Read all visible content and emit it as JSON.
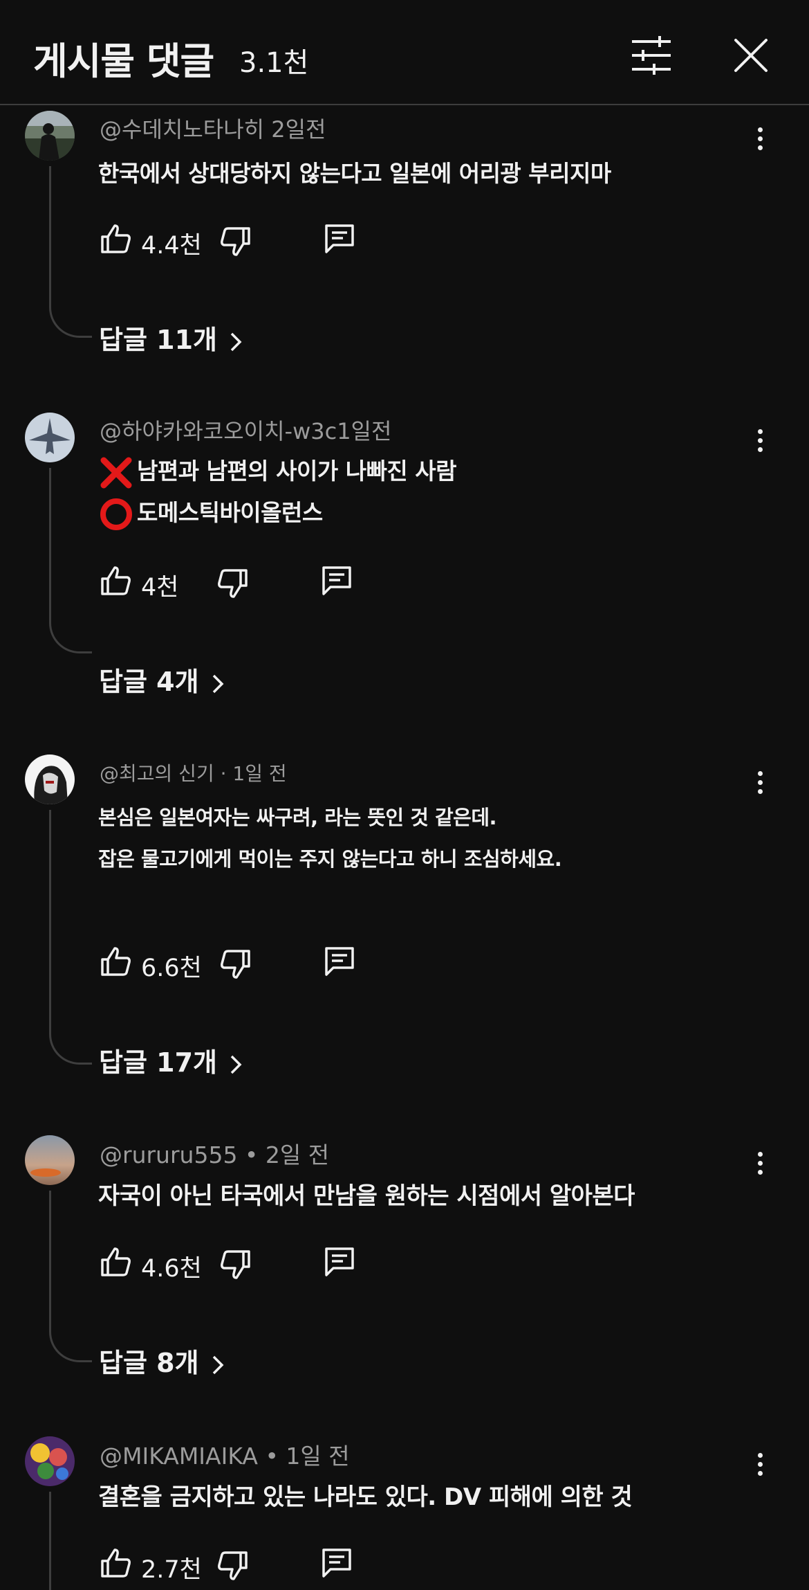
{
  "header": {
    "title": "게시물 댓글",
    "count": "3.1천"
  },
  "comments": [
    {
      "author": "@수데치노타나히 2일전",
      "lines": [
        "한국에서 상대당하지 않는다고 일본에 어리광 부리지마"
      ],
      "likes": "4.4천",
      "replies": "답글 11개",
      "avatar": "dark-silhouette"
    },
    {
      "author": "@하야카와코오이치-w3c1일전",
      "lines": [
        "남편과 남편의 사이가 나빠진 사람",
        "도메스틱바이올런스"
      ],
      "line_icons": [
        "cross-mark-icon",
        "circle-mark-icon"
      ],
      "likes": "4천",
      "replies": "답글 4개",
      "avatar": "jet"
    },
    {
      "author": "@최고의 신기 · 1일 전",
      "lines": [
        "본심은 일본여자는 싸구려, 라는 뜻인 것 같은데.",
        "잡은 물고기에게 먹이는 주지 않는다고 하니 조심하세요."
      ],
      "likes": "6.6천",
      "replies": "답글 17개",
      "avatar": "character"
    },
    {
      "author": "@rururu555 • 2일 전",
      "lines": [
        "자국이 아닌 타국에서 만남을 원하는 시점에서 알아본다"
      ],
      "likes": "4.6천",
      "replies": "답글 8개",
      "avatar": "sunset"
    },
    {
      "author": "@MIKAMIAIKA • 1일 전",
      "lines": [
        "결혼을 금지하고 있는 나라도 있다. DV 피해에 의한 것"
      ],
      "likes": "2.7천",
      "replies": "",
      "avatar": "colorful"
    }
  ],
  "colors": {
    "background": "#0f0f0f",
    "text": "#f1f1f1",
    "muted": "#9c9c9c",
    "thread": "#3e3e3e",
    "cross": "#e31919"
  }
}
